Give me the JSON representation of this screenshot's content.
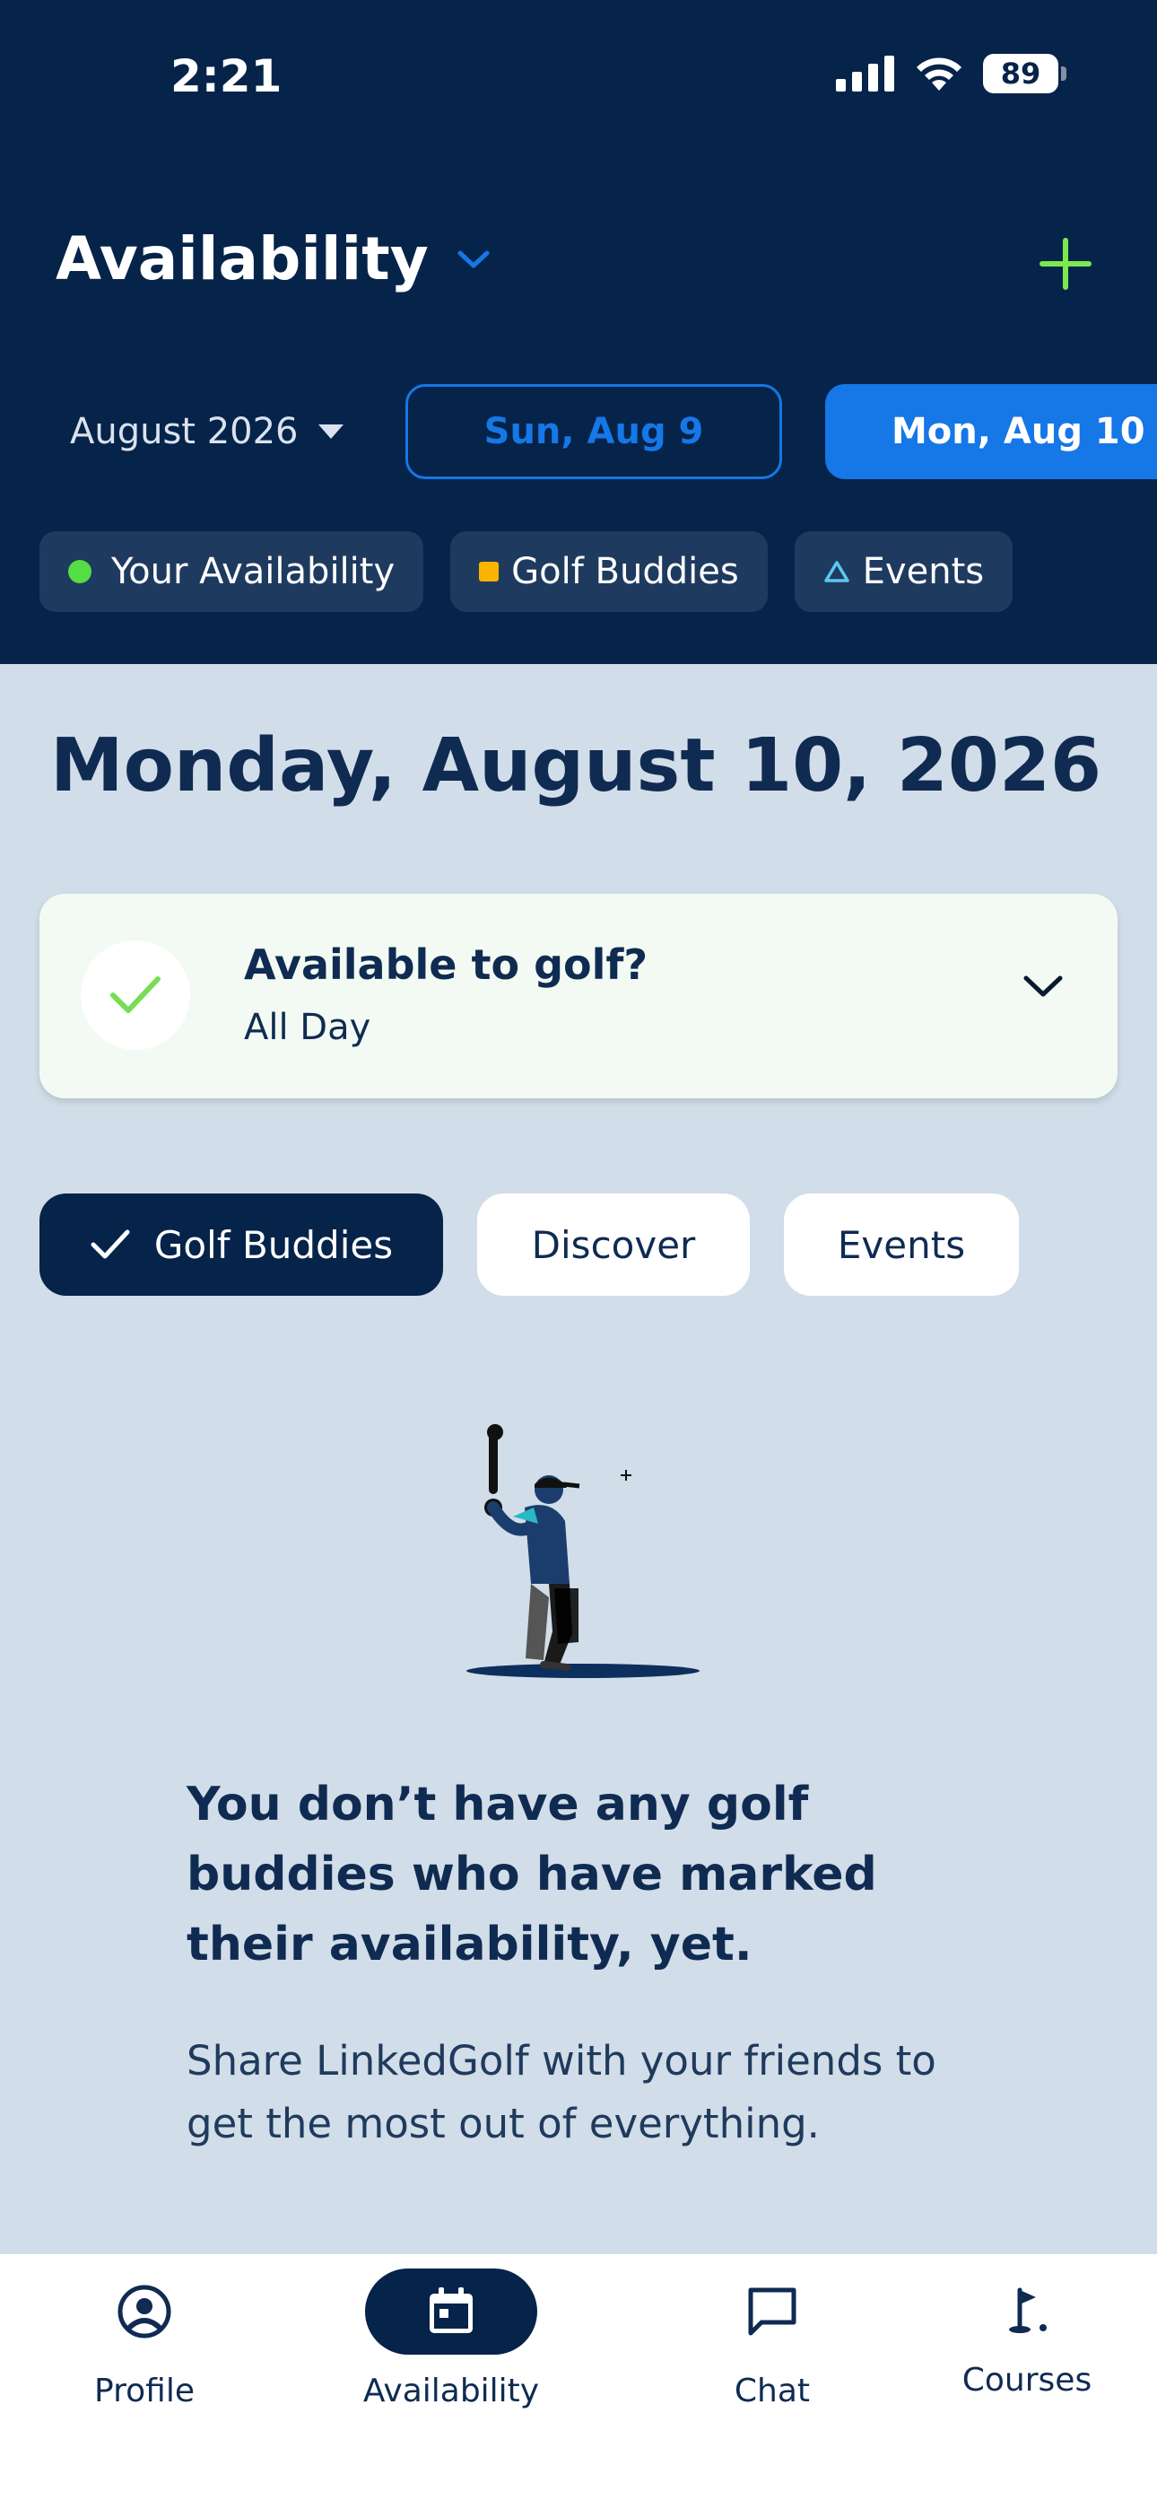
{
  "status_bar": {
    "time": "2:21",
    "battery": "89"
  },
  "header": {
    "title": "Availability",
    "month": "August 2026",
    "dates": [
      "Sun, Aug 9",
      "Mon, Aug 10"
    ],
    "legend": [
      "Your Availability",
      "Golf Buddies",
      "Events"
    ]
  },
  "main": {
    "date_heading": "Monday, August 10, 2026",
    "availability_card": {
      "question": "Available to golf?",
      "value": "All Day"
    },
    "filters": [
      "Golf Buddies",
      "Discover",
      "Events"
    ],
    "empty_title": "You don’t have any golf buddies who have marked their availability, yet.",
    "empty_body": "Share LinkedGolf with your friends to get the most out of everything."
  },
  "tabbar": {
    "items": [
      "Profile",
      "Availability",
      "Chat",
      "Courses"
    ]
  },
  "colors": {
    "header_bg": "#06234a",
    "accent": "#1677e6",
    "success": "#55dd44",
    "page_bg": "#d1dde8"
  }
}
